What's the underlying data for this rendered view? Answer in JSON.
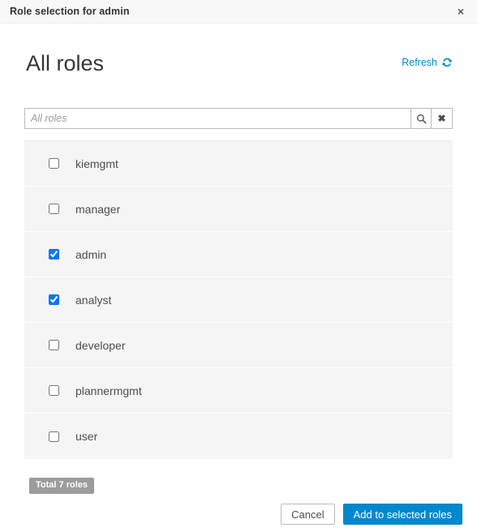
{
  "titlebar": {
    "title": "Role selection for admin",
    "close_label": "×"
  },
  "header": {
    "title": "All roles",
    "refresh_label": "Refresh",
    "refresh_icon": "refresh-icon",
    "accent_color": "#0088ce"
  },
  "search": {
    "value": "",
    "placeholder": "All roles",
    "search_icon": "search-icon",
    "clear_label": "✖",
    "clear_icon": "clear-icon"
  },
  "roles": [
    {
      "name": "kiemgmt",
      "checked": false
    },
    {
      "name": "manager",
      "checked": false
    },
    {
      "name": "admin",
      "checked": true
    },
    {
      "name": "analyst",
      "checked": true
    },
    {
      "name": "developer",
      "checked": false
    },
    {
      "name": "plannermgmt",
      "checked": false
    },
    {
      "name": "user",
      "checked": false
    }
  ],
  "summary": {
    "total_badge": "Total 7 roles"
  },
  "footer": {
    "cancel_label": "Cancel",
    "submit_label": "Add to selected roles"
  }
}
